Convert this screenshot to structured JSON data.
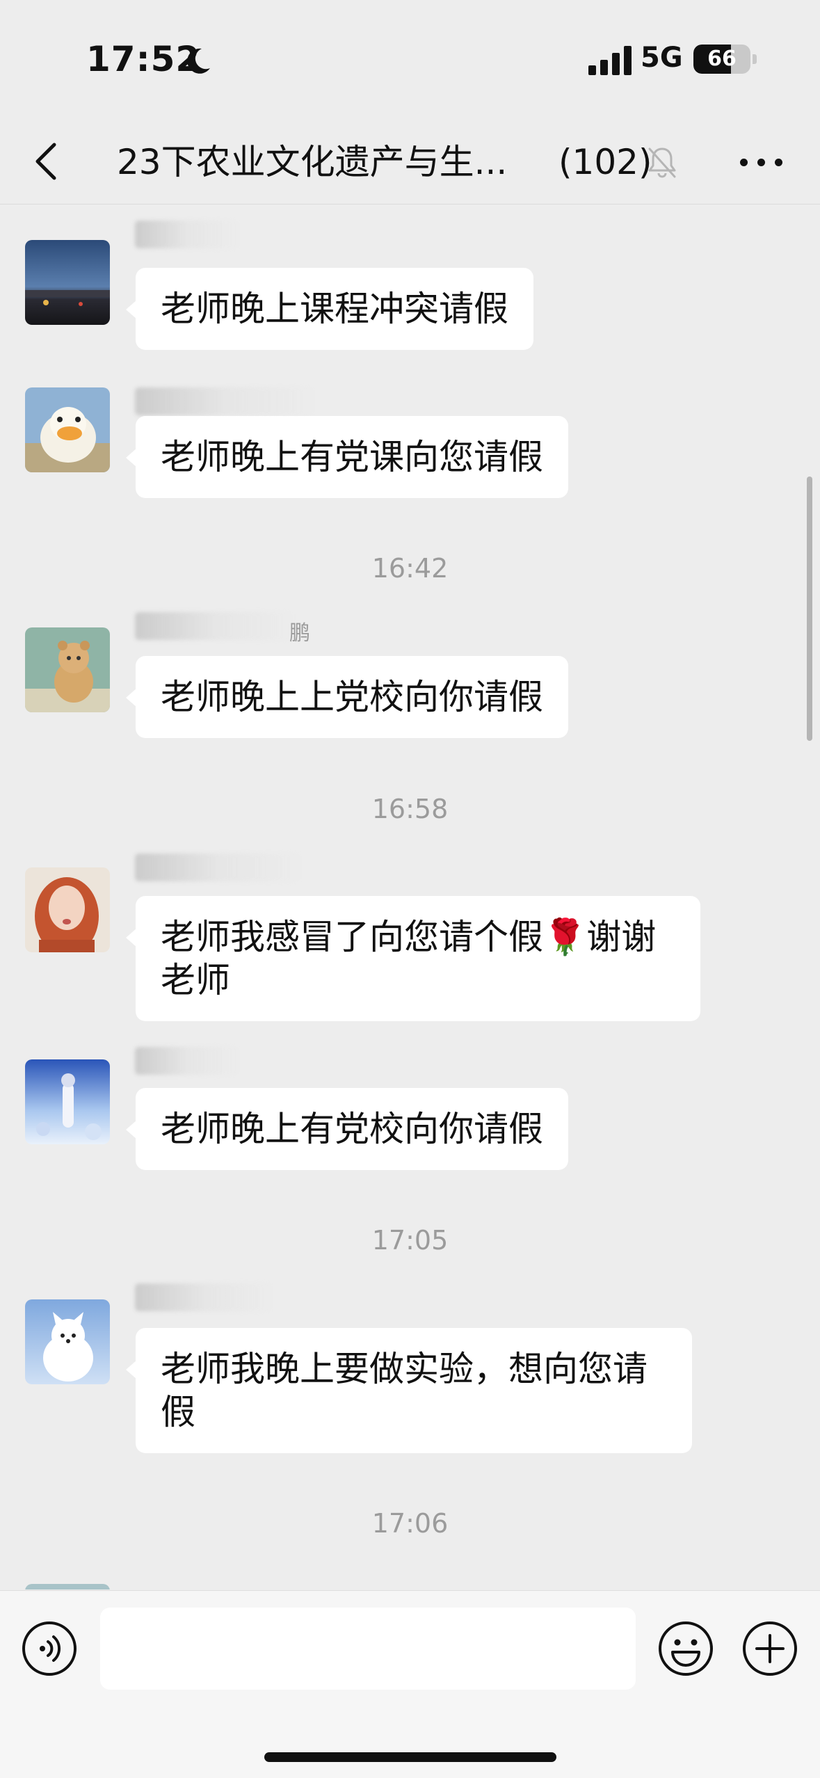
{
  "status_bar": {
    "time": "17:52",
    "network": "5G",
    "battery_level": "66",
    "battery_fraction": 0.66
  },
  "nav": {
    "title": "23下农业文化遗产与生...",
    "member_count": "(102)",
    "icons": [
      "back-icon",
      "mute-icon",
      "more-icon"
    ]
  },
  "messages": [
    {
      "type": "message",
      "sender_fragment": "",
      "text": "老师晚上课程冲突请假",
      "avatar": "city-dusk"
    },
    {
      "type": "message",
      "sender_fragment": "",
      "text": "老师晚上有党课向您请假",
      "avatar": "duck"
    },
    {
      "type": "time",
      "text": "16:42"
    },
    {
      "type": "message",
      "sender_fragment": "鹏",
      "text": "老师晚上上党校向你请假",
      "avatar": "bear"
    },
    {
      "type": "time",
      "text": "16:58"
    },
    {
      "type": "message",
      "sender_fragment": "",
      "text_line1": "老师我感冒了向您请个假🌹谢谢",
      "text_line2": "老师",
      "avatar": "girl"
    },
    {
      "type": "message",
      "sender_fragment": "",
      "text": "老师晚上有党校向你请假",
      "avatar": "anime"
    },
    {
      "type": "time",
      "text": "17:05"
    },
    {
      "type": "message",
      "sender_fragment": "",
      "text_line1": "老师我晚上要做实验，想向您请",
      "text_line2": "假",
      "avatar": "white-dog"
    },
    {
      "type": "time",
      "text": "17:06"
    }
  ],
  "input": {
    "placeholder": "",
    "icons": [
      "voice-icon",
      "emoji-icon",
      "plus-icon"
    ]
  },
  "colors": {
    "background": "#ededed",
    "bubble": "#ffffff",
    "timestamp": "#9b9b9b",
    "input_bar": "#f6f6f6"
  }
}
